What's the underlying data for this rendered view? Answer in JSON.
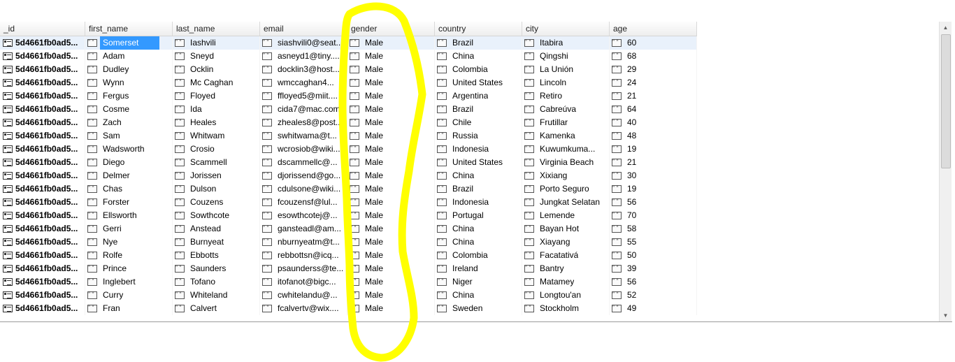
{
  "columns": [
    "_id",
    "first_name",
    "last_name",
    "email",
    "gender",
    "country",
    "city",
    "age"
  ],
  "rows": [
    [
      "5d4661fb0ad5...",
      "Somerset",
      "Iashvili",
      "siashvili0@seat...",
      "Male",
      "Brazil",
      "Itabira",
      "60"
    ],
    [
      "5d4661fb0ad5...",
      "Adam",
      "Sneyd",
      "asneyd1@tiny....",
      "Male",
      "China",
      "Qingshi",
      "68"
    ],
    [
      "5d4661fb0ad5...",
      "Dudley",
      "Ocklin",
      "docklin3@host...",
      "Male",
      "Colombia",
      "La Unión",
      "29"
    ],
    [
      "5d4661fb0ad5...",
      "Wynn",
      "Mc Caghan",
      "wmccaghan4...",
      "Male",
      "United States",
      "Lincoln",
      "24"
    ],
    [
      "5d4661fb0ad5...",
      "Fergus",
      "Floyed",
      "ffloyed5@miit....",
      "Male",
      "Argentina",
      "Retiro",
      "21"
    ],
    [
      "5d4661fb0ad5...",
      "Cosme",
      "Ida",
      "cida7@mac.com",
      "Male",
      "Brazil",
      "Cabreúva",
      "64"
    ],
    [
      "5d4661fb0ad5...",
      "Zach",
      "Heales",
      "zheales8@post...",
      "Male",
      "Chile",
      "Frutillar",
      "40"
    ],
    [
      "5d4661fb0ad5...",
      "Sam",
      "Whitwam",
      "swhitwama@t...",
      "Male",
      "Russia",
      "Kamenka",
      "48"
    ],
    [
      "5d4661fb0ad5...",
      "Wadsworth",
      "Crosio",
      "wcrosiob@wiki...",
      "Male",
      "Indonesia",
      "Kuwumkuma...",
      "19"
    ],
    [
      "5d4661fb0ad5...",
      "Diego",
      "Scammell",
      "dscammellc@...",
      "Male",
      "United States",
      "Virginia Beach",
      "21"
    ],
    [
      "5d4661fb0ad5...",
      "Delmer",
      "Jorissen",
      "djorissend@go...",
      "Male",
      "China",
      "Xixiang",
      "30"
    ],
    [
      "5d4661fb0ad5...",
      "Chas",
      "Dulson",
      "cdulsone@wiki...",
      "Male",
      "Brazil",
      "Porto Seguro",
      "19"
    ],
    [
      "5d4661fb0ad5...",
      "Forster",
      "Couzens",
      "fcouzensf@lul...",
      "Male",
      "Indonesia",
      "Jungkat Selatan",
      "56"
    ],
    [
      "5d4661fb0ad5...",
      "Ellsworth",
      "Sowthcote",
      "esowthcotej@...",
      "Male",
      "Portugal",
      "Lemende",
      "70"
    ],
    [
      "5d4661fb0ad5...",
      "Gerri",
      "Anstead",
      "gansteadl@am...",
      "Male",
      "China",
      "Bayan Hot",
      "58"
    ],
    [
      "5d4661fb0ad5...",
      "Nye",
      "Burnyeat",
      "nburnyeatm@t...",
      "Male",
      "China",
      "Xiayang",
      "55"
    ],
    [
      "5d4661fb0ad5...",
      "Rolfe",
      "Ebbotts",
      "rebbottsn@icq...",
      "Male",
      "Colombia",
      "Facatativá",
      "50"
    ],
    [
      "5d4661fb0ad5...",
      "Prince",
      "Saunders",
      "psaunderss@te...",
      "Male",
      "Ireland",
      "Bantry",
      "39"
    ],
    [
      "5d4661fb0ad5...",
      "Inglebert",
      "Tofano",
      "itofanot@bigc...",
      "Male",
      "Niger",
      "Matamey",
      "56"
    ],
    [
      "5d4661fb0ad5...",
      "Curry",
      "Whiteland",
      "cwhitelandu@...",
      "Male",
      "China",
      "Longtou'an",
      "52"
    ],
    [
      "5d4661fb0ad5...",
      "Fran",
      "Calvert",
      "fcalvertv@wix....",
      "Male",
      "Sweden",
      "Stockholm",
      "49"
    ]
  ],
  "colors": {
    "selection": "#3399ff",
    "selected_row": "#e9f1fb",
    "annotation": "#ffff00"
  }
}
